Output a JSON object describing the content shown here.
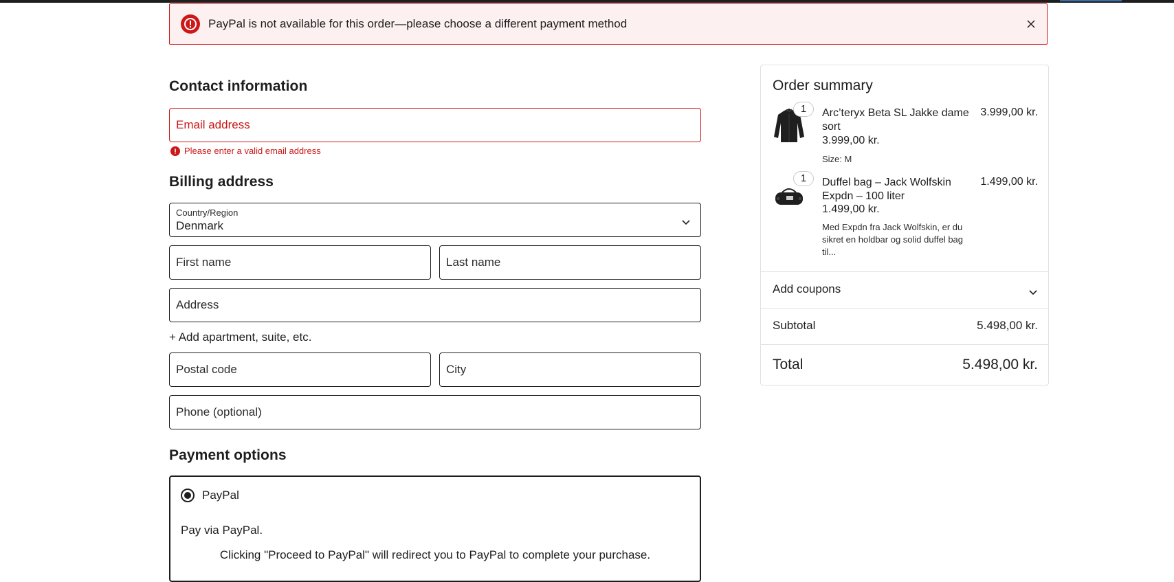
{
  "alert": {
    "message": "PayPal is not available for this order—please choose a different payment method",
    "icon": "error-icon",
    "close_icon": "close-icon",
    "color": "#cc1818"
  },
  "contact": {
    "heading": "Contact information",
    "email_placeholder": "Email address",
    "email_value": "",
    "email_error": "Please enter a valid email address"
  },
  "billing": {
    "heading": "Billing address",
    "country_label": "Country/Region",
    "country_value": "Denmark",
    "first_name_placeholder": "First name",
    "last_name_placeholder": "Last name",
    "address_placeholder": "Address",
    "add_apartment": "+ Add apartment, suite, etc.",
    "postal_code_placeholder": "Postal code",
    "city_placeholder": "City",
    "phone_placeholder": "Phone (optional)"
  },
  "payment": {
    "heading": "Payment options",
    "selected_option": "PayPal",
    "description": "Pay via PayPal.",
    "note": "Clicking \"Proceed to PayPal\" will redirect you to PayPal to complete your purchase."
  },
  "summary": {
    "title": "Order summary",
    "items": [
      {
        "quantity": "1",
        "name": "Arc’teryx Beta SL Jakke dame sort",
        "price": "3.999,00 kr.",
        "meta": "Size: M",
        "total": "3.999,00 kr.",
        "icon": "jacket-thumbnail"
      },
      {
        "quantity": "1",
        "name": "Duffel bag – Jack Wolfskin Expdn – 100 liter",
        "price": "1.499,00 kr.",
        "meta": "Med Expdn fra Jack Wolfskin, er du sikret en holdbar og solid duffel bag til...",
        "total": "1.499,00 kr.",
        "icon": "duffel-bag-thumbnail"
      }
    ],
    "coupons_label": "Add coupons",
    "subtotal_label": "Subtotal",
    "subtotal_value": "5.498,00 kr.",
    "total_label": "Total",
    "total_value": "5.498,00 kr."
  }
}
